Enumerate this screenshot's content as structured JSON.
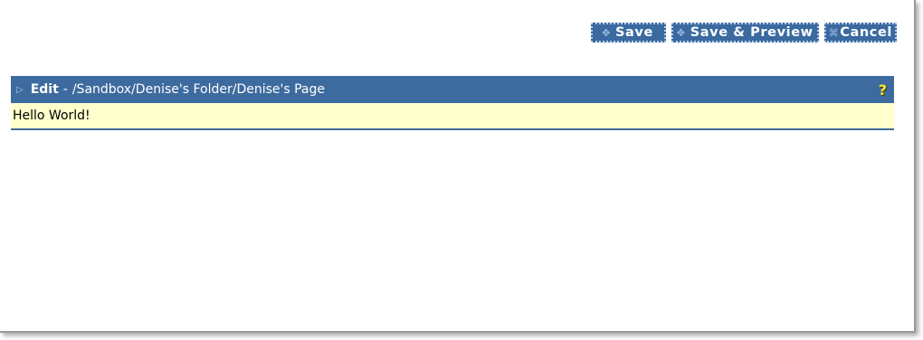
{
  "toolbar": {
    "save_label": "Save",
    "save_preview_label": "Save & Preview",
    "cancel_label": "Cancel"
  },
  "panel": {
    "title_prefix": "Edit",
    "separator": "-",
    "path": "/Sandbox/Denise's Folder/Denise's Page",
    "help_label": "?",
    "content_text": "Hello World!"
  },
  "icons": {
    "save": "save-icon",
    "save_preview": "save-preview-icon",
    "cancel": "cancel-icon",
    "panel_arrow": "arrow-right-icon",
    "help": "help-icon"
  },
  "colors": {
    "button_bg": "#3a6aa0",
    "titlebar_bg": "#3e6b9f",
    "content_bg": "#ffffcc",
    "help_fg": "#ffe233"
  }
}
